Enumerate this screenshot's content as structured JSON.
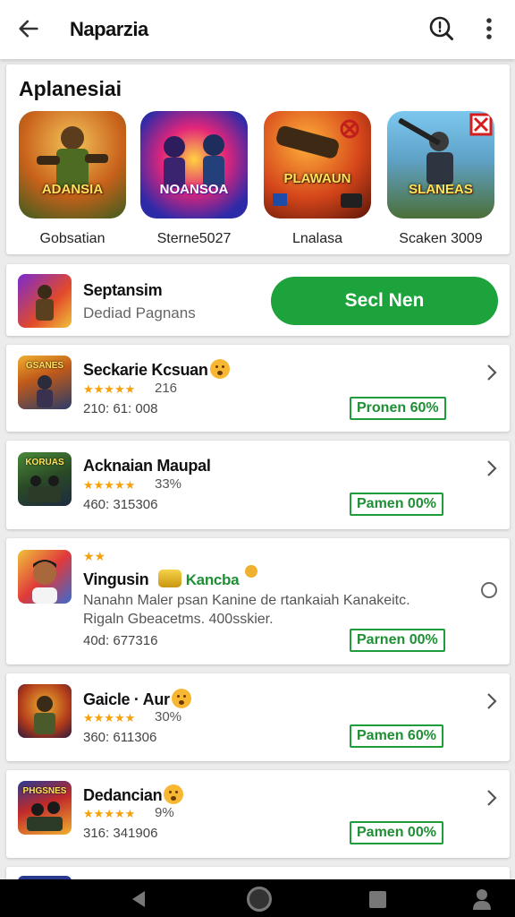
{
  "header": {
    "title": "Naparzia",
    "back_icon": "arrow-left-icon",
    "search_icon": "search-icon",
    "more_icon": "more-vertical-icon"
  },
  "featured": {
    "title": "Aplanesiai",
    "items": [
      {
        "name": "Gobsatian",
        "art_label": "ADANSIA",
        "colors": [
          "#e0852a",
          "#3b5c1f"
        ]
      },
      {
        "name": "Sterne5027",
        "art_label": "NOANSOA",
        "colors": [
          "#c2259a",
          "#2d2aa8"
        ]
      },
      {
        "name": "Lnalasa",
        "art_label": "PLAWAUN",
        "colors": [
          "#f0711c",
          "#7a1d0c"
        ]
      },
      {
        "name": "Scaken 3009",
        "art_label": "SLANEAS",
        "colors": [
          "#5fb2e0",
          "#3b5a2a"
        ]
      }
    ]
  },
  "promo_app": {
    "name": "Septansim",
    "subtitle": "Dediad Pagnans",
    "button_label": "Secl Nen"
  },
  "apps": [
    {
      "name": "Seckarie Kcsuan",
      "thumb_label": "GSANES",
      "rating": "216",
      "size": "210: 61: 008",
      "promo": "Pronen 60%"
    },
    {
      "name": "Acknaian Maupal",
      "thumb_label": "KORUAS",
      "rating": "33%",
      "size": "460: 315306",
      "promo": "Pamen 00%"
    },
    {
      "name": "Vingusin",
      "badge_text": "Kancba",
      "desc_line1": "Nanahn Maler psan Kanine de rtankaiah Kanakeitc.",
      "desc_line2": "Rigaln Gbeacetms. 400sskier.",
      "size": "40d: 677316",
      "promo": "Parnen 00%"
    },
    {
      "name": "Gaicle · Aur",
      "rating": "30%",
      "size": "360: 611306",
      "promo": "Pamen 60%"
    },
    {
      "name": "Dedancian",
      "thumb_label": "PHGSNES",
      "rating": "9%",
      "size": "316: 341906",
      "promo": "Pamen 00%"
    }
  ],
  "colors": {
    "accent_green": "#1ca33b",
    "star": "#f5a10a"
  },
  "nav": {
    "icons": [
      "back-triangle-icon",
      "home-circle-icon",
      "recent-square-icon",
      "person-icon"
    ]
  }
}
